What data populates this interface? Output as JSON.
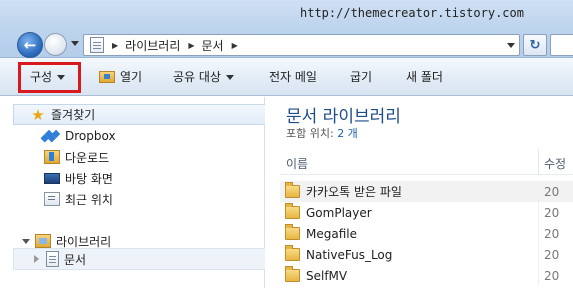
{
  "watermark": "http://themecreator.tistory.com",
  "address": {
    "crumbs": [
      "라이브러리",
      "문서"
    ]
  },
  "commandbar": {
    "organize": "구성",
    "open": "열기",
    "share": "공유 대상",
    "email": "전자 메일",
    "burn": "굽기",
    "new_folder": "새 폴더"
  },
  "nav": {
    "favorites": "즐겨찾기",
    "dropbox": "Dropbox",
    "downloads": "다운로드",
    "desktop": "바탕 화면",
    "recent": "최근 위치",
    "libraries": "라이브러리",
    "documents": "문서"
  },
  "content": {
    "title": "문서 라이브러리",
    "includes_label": "포함 위치:",
    "includes_value": "2 개",
    "col_name": "이름",
    "col_date": "수정",
    "files": [
      {
        "name": "카카오톡 받은 파일",
        "date": "20"
      },
      {
        "name": "GomPlayer",
        "date": "20"
      },
      {
        "name": "Megafile",
        "date": "20"
      },
      {
        "name": "NativeFus_Log",
        "date": "20"
      },
      {
        "name": "SelfMV",
        "date": "20"
      }
    ]
  }
}
